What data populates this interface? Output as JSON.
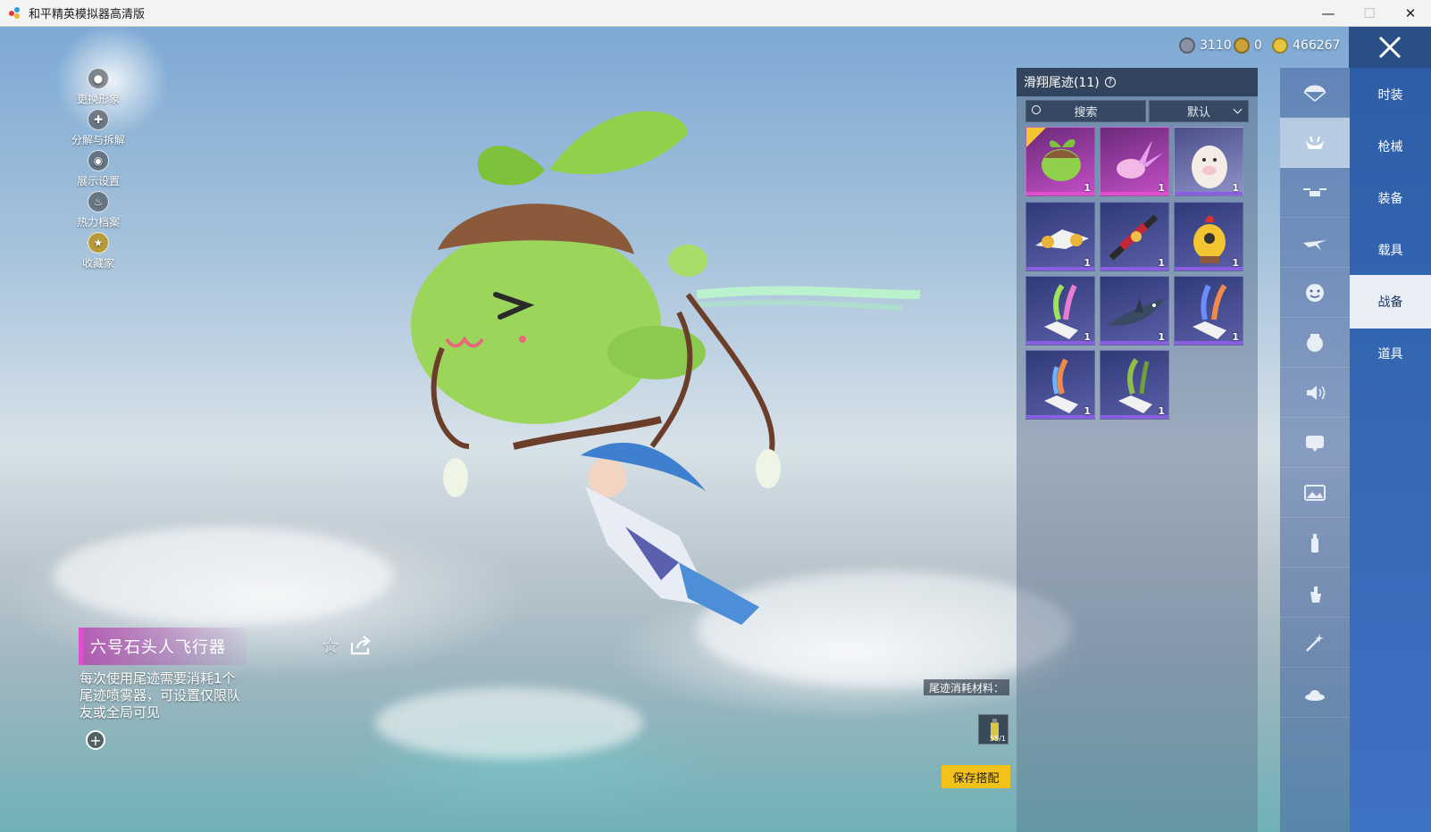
{
  "window": {
    "title": "和平精英模拟器高清版",
    "controls": {
      "minimize": "—",
      "maximize": "☐",
      "close": "✕"
    }
  },
  "currency": [
    {
      "icon": "silver-coin-icon",
      "value": "3110",
      "color": "#8a93a6"
    },
    {
      "icon": "gold-token-icon",
      "value": "0",
      "color": "#c9a23a"
    },
    {
      "icon": "gold-coin-icon",
      "value": "466267",
      "color": "#e7c53e"
    }
  ],
  "left_actions": [
    {
      "label": "更换形象",
      "icon": "avatar-icon"
    },
    {
      "label": "分解与拆解",
      "icon": "puzzle-icon"
    },
    {
      "label": "展示设置",
      "icon": "eye-icon"
    },
    {
      "label": "热力档案",
      "icon": "flame-icon"
    },
    {
      "label": "收藏家",
      "icon": "collector-badge-icon"
    }
  ],
  "item": {
    "name": "六号石头人飞行器",
    "description": "每次使用尾迹需要消耗1个尾迹喷雾器，可设置仅限队友或全局可见"
  },
  "panel": {
    "title": "滑翔尾迹(11)",
    "search_label": "搜索",
    "sort_label": "默认",
    "items": [
      {
        "name": "sprout-glider",
        "qty": "1",
        "rarity": "legendary",
        "equipped": true
      },
      {
        "name": "crystal-glider",
        "qty": "1",
        "rarity": "legendary",
        "equipped": false
      },
      {
        "name": "alpaca-glider",
        "qty": "1",
        "rarity": "epic",
        "equipped": false
      },
      {
        "name": "jet-glider",
        "qty": "1",
        "rarity": "epic",
        "equipped": false
      },
      {
        "name": "red-mech-glider",
        "qty": "1",
        "rarity": "epic",
        "equipped": false
      },
      {
        "name": "chicken-glider",
        "qty": "1",
        "rarity": "epic",
        "equipped": false
      },
      {
        "name": "rainbow-trail",
        "qty": "1",
        "rarity": "epic",
        "equipped": false
      },
      {
        "name": "shark-glider",
        "qty": "1",
        "rarity": "epic",
        "equipped": false
      },
      {
        "name": "rainbow-trail-2",
        "qty": "1",
        "rarity": "epic",
        "equipped": false
      },
      {
        "name": "fire-trail",
        "qty": "1",
        "rarity": "epic",
        "equipped": false
      },
      {
        "name": "green-trail",
        "qty": "1",
        "rarity": "epic",
        "equipped": false
      }
    ],
    "cost_label": "尾迹消耗材料：",
    "cost_qty": "55/1",
    "save_label": "保存搭配"
  },
  "icon_tabs": [
    {
      "icon": "parachute-icon",
      "active": false
    },
    {
      "icon": "glider-trail-icon",
      "active": true
    },
    {
      "icon": "drone-icon",
      "active": false
    },
    {
      "icon": "plane-icon",
      "active": false
    },
    {
      "icon": "emote-face-icon",
      "active": false
    },
    {
      "icon": "pet-icon",
      "active": false
    },
    {
      "icon": "voice-icon",
      "active": false
    },
    {
      "icon": "chat-bubble-icon",
      "active": false
    },
    {
      "icon": "photo-icon",
      "active": false
    },
    {
      "icon": "spray-icon",
      "active": false
    },
    {
      "icon": "gesture-icon",
      "active": false
    },
    {
      "icon": "sparkle-wand-icon",
      "active": false
    },
    {
      "icon": "landing-icon",
      "active": false
    }
  ],
  "categories": [
    {
      "label": "时装",
      "active": false
    },
    {
      "label": "枪械",
      "active": false
    },
    {
      "label": "装备",
      "active": false
    },
    {
      "label": "载具",
      "active": false
    },
    {
      "label": "战备",
      "active": true
    },
    {
      "label": "道具",
      "active": false
    }
  ],
  "colors": {
    "accent_pink": "#e04fd0",
    "save_yellow": "#f3c21a",
    "category_blue": "#2f5ea8"
  }
}
